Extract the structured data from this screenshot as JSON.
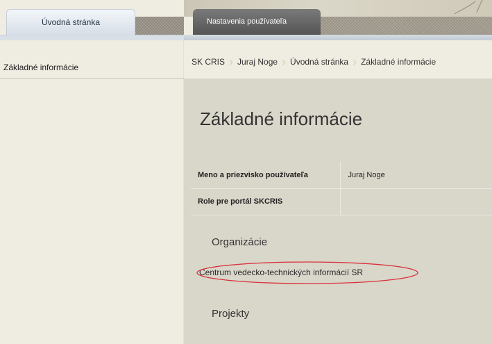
{
  "tabs": [
    {
      "label": "Úvodná stránka",
      "active": true
    },
    {
      "label": "Nastavenia používateľa",
      "active": false
    }
  ],
  "sidebar": {
    "items": [
      {
        "label": "Základné informácie"
      }
    ]
  },
  "breadcrumb": [
    "SK CRIS",
    "Juraj Noge",
    "Úvodná stránka",
    "Základné informácie"
  ],
  "page_title": "Základné informácie",
  "info_rows": [
    {
      "label": "Meno a priezvisko používateľa",
      "value": "Juraj Noge"
    },
    {
      "label": "Role pre portál SKCRIS",
      "value": ""
    }
  ],
  "organizations": {
    "heading": "Organizácie",
    "items": [
      "Centrum vedecko-technických informácií SR"
    ]
  },
  "projects": {
    "heading": "Projekty"
  },
  "colors": {
    "sidebar_bg": "#efece1",
    "content_bg": "#d9d6ca",
    "active_tab_bg": "#dde3ea",
    "inactive_tab_bg": "#666666",
    "highlight_ellipse": "#d9303a"
  }
}
